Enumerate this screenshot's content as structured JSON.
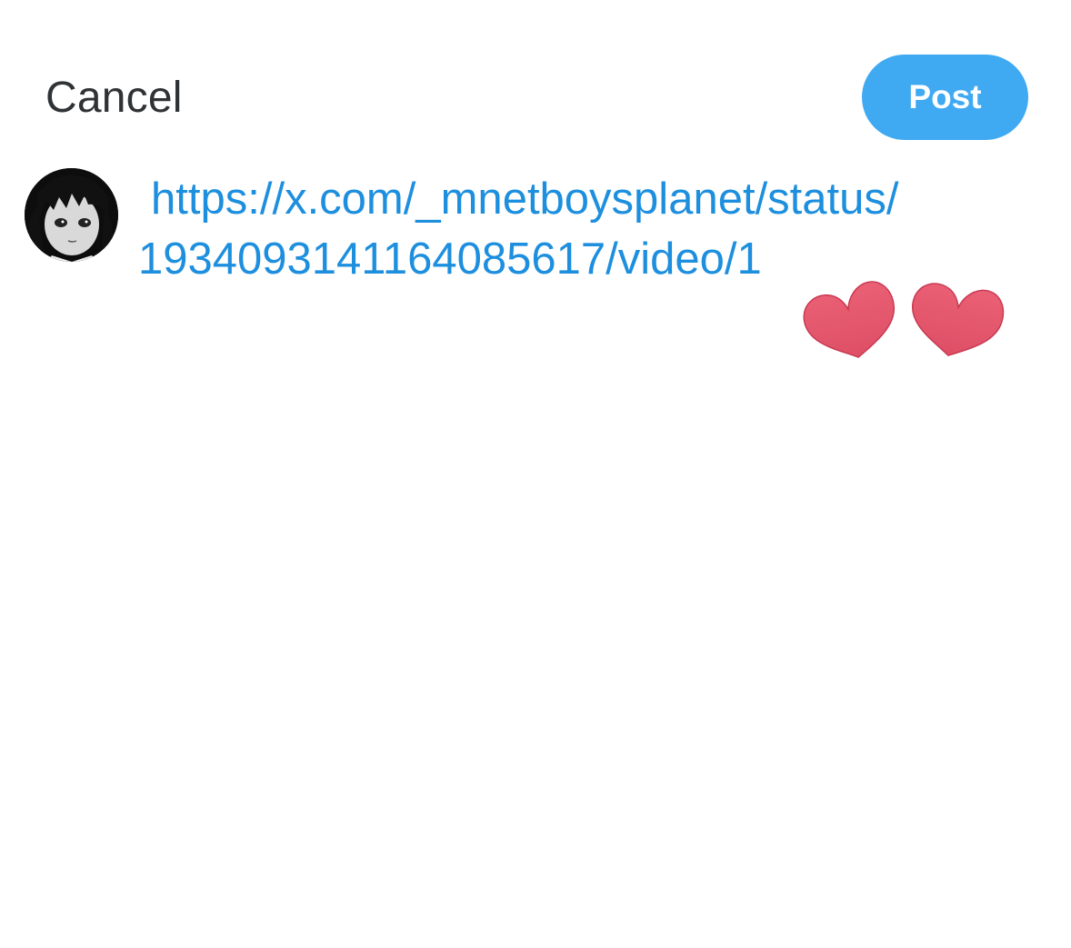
{
  "header": {
    "cancel_label": "Cancel",
    "post_label": "Post"
  },
  "compose": {
    "text_line1": "https://x.com/_mnetboysplanet/status/",
    "text_line2": "1934093141164085617/video/1",
    "emoji": "❤️❤️"
  },
  "icons": {
    "avatar": "user-avatar",
    "hearts": "red-heart-emoji"
  },
  "colors": {
    "accent": "#3fa9f2",
    "link": "#1d8fde",
    "text": "#2f3336",
    "heart": "#e55a6e"
  }
}
